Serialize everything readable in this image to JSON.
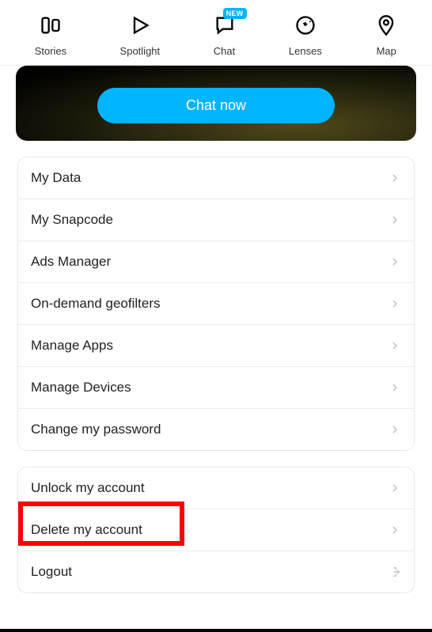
{
  "nav": {
    "stories": "Stories",
    "spotlight": "Spotlight",
    "chat": "Chat",
    "chat_badge": "NEW",
    "lenses": "Lenses",
    "map": "Map"
  },
  "hero": {
    "chat_button": "Chat now"
  },
  "list1": {
    "my_data": "My Data",
    "my_snapcode": "My Snapcode",
    "ads_manager": "Ads Manager",
    "geofilters": "On-demand geofilters",
    "manage_apps": "Manage Apps",
    "manage_devices": "Manage Devices",
    "change_password": "Change my password"
  },
  "list2": {
    "unlock": "Unlock my account",
    "delete": "Delete my account",
    "logout": "Logout"
  }
}
